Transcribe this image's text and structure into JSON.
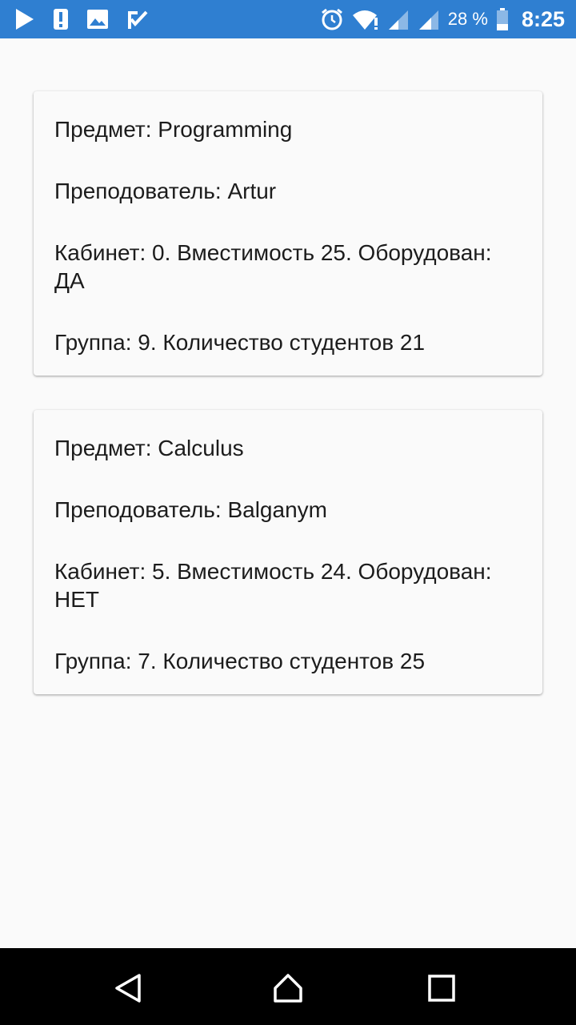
{
  "status_bar": {
    "battery_percent": "28 %",
    "time": "8:25",
    "icons": [
      "play-store-icon",
      "alert-icon",
      "gallery-icon",
      "task-check-icon",
      "alarm-icon",
      "wifi-icon",
      "signal-icon",
      "signal-icon-2",
      "battery-icon"
    ]
  },
  "lessons": [
    {
      "subject": "Предмет: Programming",
      "teacher": "Преподователь: Artur",
      "room": "Кабинет: 0. Вместимость 25. Оборудован: ДА",
      "group": "Группа: 9. Количество студентов 21"
    },
    {
      "subject": "Предмет: Calculus",
      "teacher": "Преподователь: Balganym",
      "room": "Кабинет: 5. Вместимость 24. Оборудован: НЕТ",
      "group": "Группа: 7. Количество студентов 25"
    }
  ],
  "nav_bar": {
    "icons": [
      "back-icon",
      "home-icon",
      "recent-apps-icon"
    ]
  },
  "colors": {
    "status_bar": "#2f7fd1",
    "background": "#fafafa",
    "text": "#1c1c1c",
    "nav_bar": "#000000"
  }
}
